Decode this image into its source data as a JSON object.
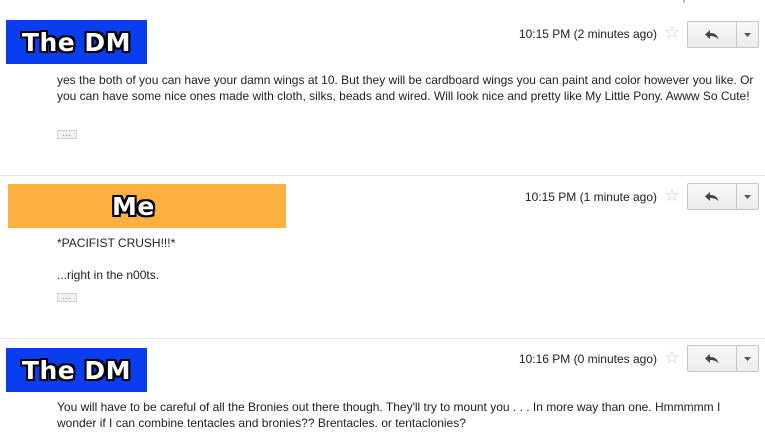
{
  "messages": [
    {
      "sender": "The DM",
      "time": "10:15 PM (2 minutes ago)",
      "body": [
        "yes the both of you can have your damn wings at 10.  But they will be cardboard wings you can paint and color however you like.  Or you can have some nice ones made with cloth, silks, beads and wired.  Will look nice and pretty like My Little Pony.  Awww So Cute!"
      ],
      "show_trimmed": "..."
    },
    {
      "sender": "Me",
      "time": "10:15 PM (1 minute ago)",
      "body": [
        "*PACIFIST CRUSH!!!*",
        "...right in the n00ts."
      ],
      "show_trimmed": "..."
    },
    {
      "sender": "The DM",
      "time": "10:16 PM (0 minutes ago)",
      "body": [
        "You will have to be careful of all the Bronies out there though.  They'll try to mount you . . . In more way than one.  Hmmmmm I wonder if I can combine tentacles and bronies??  Brentacles.  or tentaclonies?"
      ]
    }
  ],
  "colors": {
    "dm_banner": "#0a3cf0",
    "me_banner": "#fbb040",
    "star": "#c8c8c8",
    "divider": "#e5e5e5"
  },
  "icons": {
    "star": "star-icon",
    "reply": "reply-arrow-icon",
    "more": "dropdown-caret-icon"
  }
}
